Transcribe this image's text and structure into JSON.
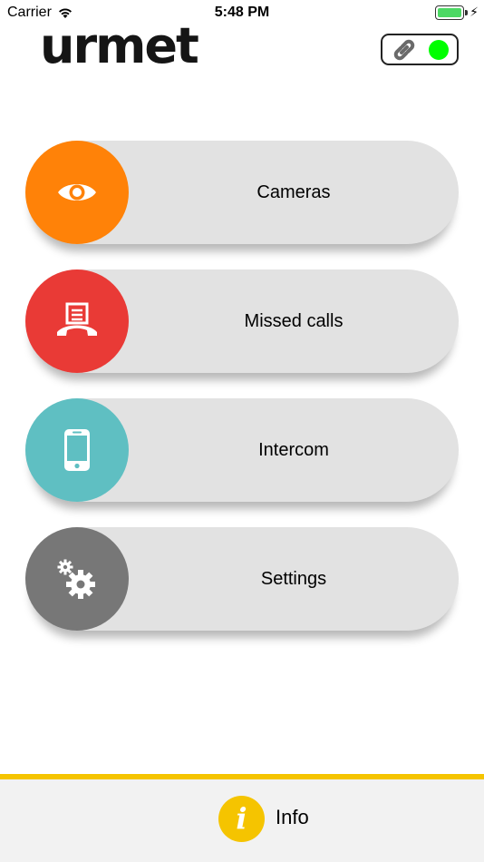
{
  "status_bar": {
    "carrier": "Carrier",
    "time": "5:48 PM",
    "battery_level": 1.0
  },
  "header": {
    "logo_text": "urmet",
    "link_icon": "link-icon",
    "connection_status_color": "#00ff00"
  },
  "menu": {
    "items": [
      {
        "label": "Cameras",
        "icon": "eye-icon",
        "color": "#ff8208"
      },
      {
        "label": "Missed calls",
        "icon": "missed-call-icon",
        "color": "#e93a36"
      },
      {
        "label": "Intercom",
        "icon": "smartphone-icon",
        "color": "#5fbfc2"
      },
      {
        "label": "Settings",
        "icon": "gears-icon",
        "color": "#777777"
      }
    ]
  },
  "footer": {
    "info_symbol": "i",
    "info_label": "Info",
    "accent_color": "#f5c400"
  }
}
